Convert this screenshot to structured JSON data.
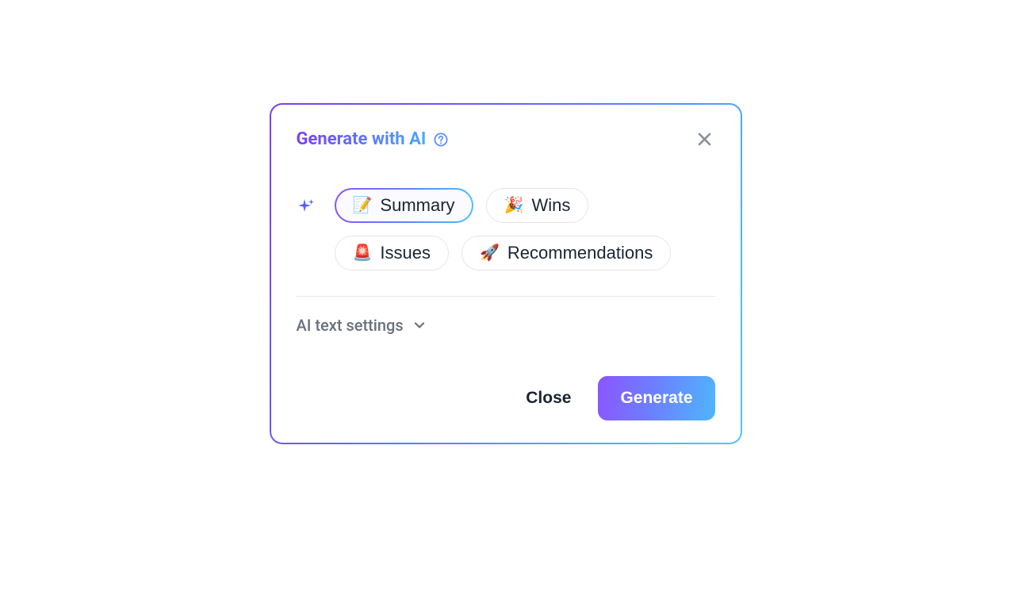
{
  "dialog": {
    "title": "Generate with AI",
    "options": [
      {
        "emoji": "📝",
        "label": "Summary",
        "selected": true
      },
      {
        "emoji": "🎉",
        "label": "Wins",
        "selected": false
      },
      {
        "emoji": "🚨",
        "label": "Issues",
        "selected": false
      },
      {
        "emoji": "🚀",
        "label": "Recommendations",
        "selected": false
      }
    ],
    "settings_label": "AI text settings",
    "footer": {
      "close_label": "Close",
      "generate_label": "Generate"
    }
  }
}
